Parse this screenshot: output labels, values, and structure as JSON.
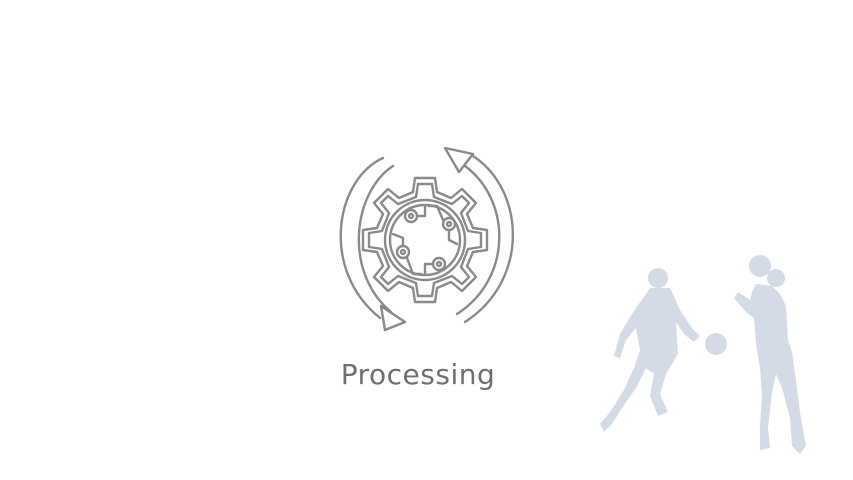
{
  "status": {
    "label": "Processing"
  },
  "icons": {
    "spinner": "gear-sync-icon",
    "decoration": "basketball-players-silhouette"
  },
  "colors": {
    "background": "#ffffff",
    "label": "#6f6f6f",
    "silhouette": "#d5dbe6"
  }
}
